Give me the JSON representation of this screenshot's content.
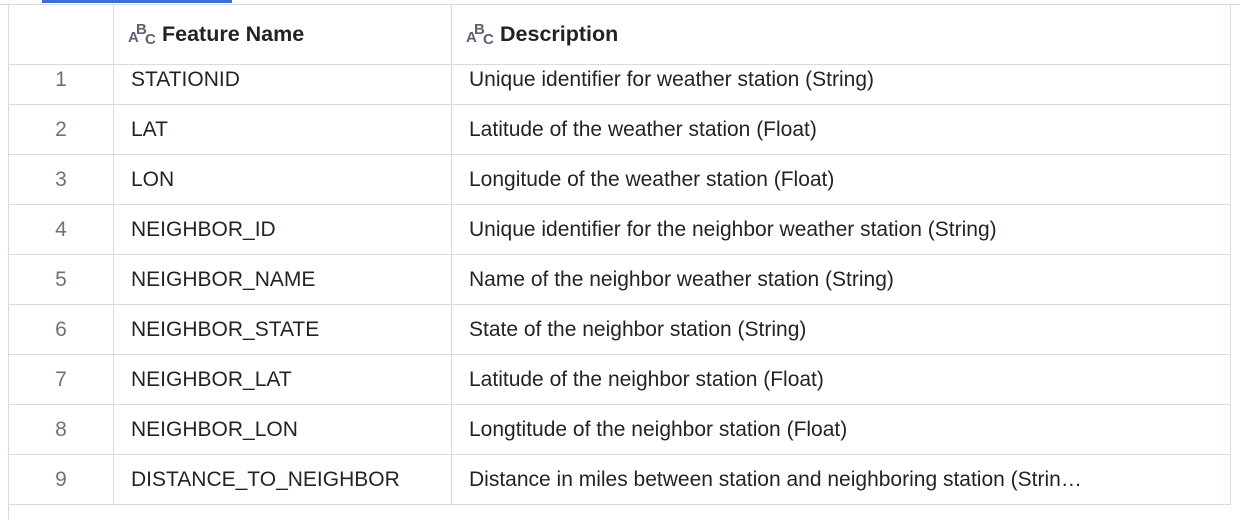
{
  "table": {
    "columns": [
      {
        "label": "Feature Name",
        "type_icon": "string-type-icon"
      },
      {
        "label": "Description",
        "type_icon": "string-type-icon"
      }
    ],
    "rows": [
      {
        "index": "1",
        "feature": "STATIONID",
        "description": "Unique identifier for weather station (String)"
      },
      {
        "index": "2",
        "feature": "LAT",
        "description": "Latitude of the weather station (Float)"
      },
      {
        "index": "3",
        "feature": "LON",
        "description": "Longitude of the weather station (Float)"
      },
      {
        "index": "4",
        "feature": "NEIGHBOR_ID",
        "description": "Unique identifier for the neighbor weather station (String)"
      },
      {
        "index": "5",
        "feature": "NEIGHBOR_NAME",
        "description": "Name of the neighbor weather station (String)"
      },
      {
        "index": "6",
        "feature": "NEIGHBOR_STATE",
        "description": "State of the neighbor station (String)"
      },
      {
        "index": "7",
        "feature": "NEIGHBOR_LAT",
        "description": "Latitude of the neighbor station (Float)"
      },
      {
        "index": "8",
        "feature": "NEIGHBOR_LON",
        "description": "Longtitude of the neighbor station (Float)"
      },
      {
        "index": "9",
        "feature": "DISTANCE_TO_NEIGHBOR",
        "description": "Distance in miles between station and neighboring station (Strin…"
      }
    ]
  },
  "colors": {
    "accent": "#3a6fd8",
    "grid_line": "#d6dce3",
    "index_text": "#6a737d"
  }
}
